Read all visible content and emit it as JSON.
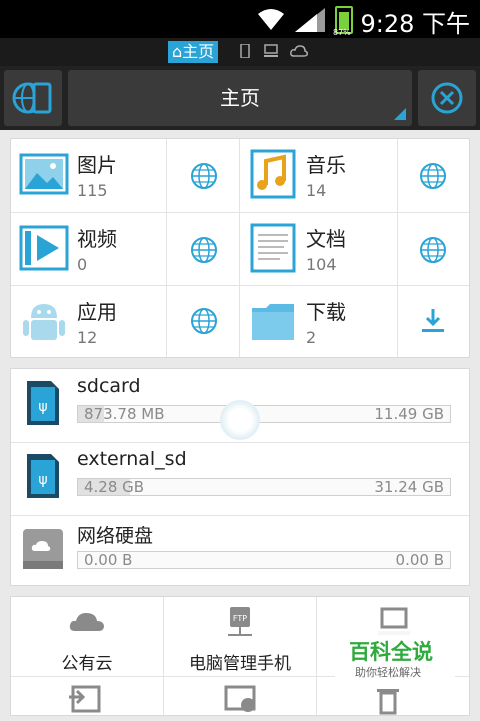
{
  "status": {
    "time": "9:28 下午",
    "battery": "87%"
  },
  "path": {
    "home_label": "⌂主页"
  },
  "toolbar": {
    "title": "主页"
  },
  "categories": [
    {
      "name": "图片",
      "count": "115"
    },
    {
      "name": "音乐",
      "count": "14"
    },
    {
      "name": "视频",
      "count": "0"
    },
    {
      "name": "文档",
      "count": "104"
    },
    {
      "name": "应用",
      "count": "12"
    },
    {
      "name": "下载",
      "count": "2"
    }
  ],
  "storage": [
    {
      "name": "sdcard",
      "used": "873.78 MB",
      "total": "11.49 GB",
      "fraction": 0.07
    },
    {
      "name": "external_sd",
      "used": "4.28 GB",
      "total": "31.24 GB",
      "fraction": 0.14
    },
    {
      "name": "网络硬盘",
      "used": "0.00 B",
      "total": "0.00 B",
      "fraction": 0
    }
  ],
  "tools": [
    {
      "label": "公有云"
    },
    {
      "label": "电脑管理手机"
    }
  ],
  "watermark": {
    "title": "百科全说",
    "subtitle": "助你轻松解决"
  },
  "colors": {
    "accent": "#2aa3d6",
    "toolbar_bg": "#3a3a3a",
    "battery": "#7bd13a"
  }
}
